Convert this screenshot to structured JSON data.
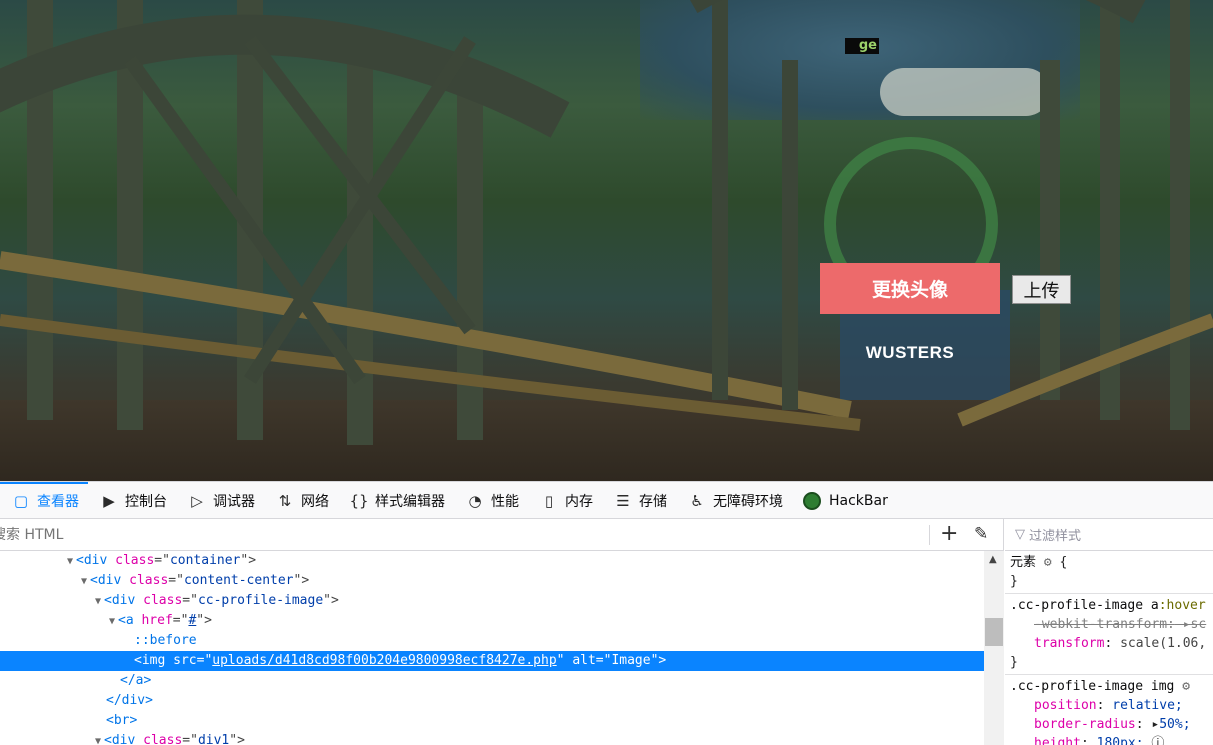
{
  "webpage": {
    "upload_label": "上传",
    "change_avatar_label": "更换头像",
    "username": "WUSTERS",
    "broken_image_text": "ge"
  },
  "devtools": {
    "tabs": [
      {
        "label": "查看器",
        "icon": "inspector-icon"
      },
      {
        "label": "控制台",
        "icon": "console-icon"
      },
      {
        "label": "调试器",
        "icon": "debugger-icon"
      },
      {
        "label": "网络",
        "icon": "network-icon"
      },
      {
        "label": "样式编辑器",
        "icon": "style-editor-icon"
      },
      {
        "label": "性能",
        "icon": "performance-icon"
      },
      {
        "label": "内存",
        "icon": "memory-icon"
      },
      {
        "label": "存储",
        "icon": "storage-icon"
      },
      {
        "label": "无障碍环境",
        "icon": "accessibility-icon"
      },
      {
        "label": "HackBar",
        "icon": "hackbar-icon"
      }
    ],
    "search_placeholder": "搜索 HTML",
    "markup": {
      "l1": {
        "tag_open": "<div ",
        "attr": "class",
        "eq": "=\"",
        "value": "container",
        "close": "\">"
      },
      "l2": {
        "tag_open": "<div ",
        "attr": "class",
        "eq": "=\"",
        "value": "content-center",
        "close": "\">"
      },
      "l3": {
        "tag_open": "<div ",
        "attr": "class",
        "eq": "=\"",
        "value": "cc-profile-image",
        "close": "\">"
      },
      "l4": {
        "tag_open": "<a ",
        "attr": "href",
        "eq": "=\"",
        "value": "#",
        "close": "\">"
      },
      "l5": {
        "pseudo": "::before"
      },
      "l6": {
        "tag_open": "<img ",
        "attr": "src",
        "eq": "=\"",
        "value": "uploads/d41d8cd98f00b204e9800998ecf8427e.php",
        "mid": "\" ",
        "attr2": "alt",
        "eq2": "=\"",
        "value2": "Image",
        "close": "\">"
      },
      "l7": {
        "text": "</a>"
      },
      "l8": {
        "text": "</div>"
      },
      "l9": {
        "text": "<br>"
      },
      "l10": {
        "tag_open": "<div ",
        "attr": "class",
        "eq": "=\"",
        "value": "div1",
        "close": "\">"
      }
    },
    "rules_filter_placeholder": "过滤样式",
    "rules": {
      "element": {
        "selector": "元素",
        "open": "{",
        "close": "}"
      },
      "hover": {
        "selector_a": ".cc-profile-image a",
        "selector_pseudo": ":hover",
        "prop1": "-webkit-transform:",
        "prop1_val": "sc",
        "prop2": "transform",
        "prop2_val": "scale(1.06,",
        "close": "}"
      },
      "img": {
        "selector": ".cc-profile-image img",
        "prop1": "position",
        "val1": "relative;",
        "prop2": "border-radius",
        "val2": "50%;",
        "prop3": "height",
        "val3": "180px;"
      }
    }
  }
}
